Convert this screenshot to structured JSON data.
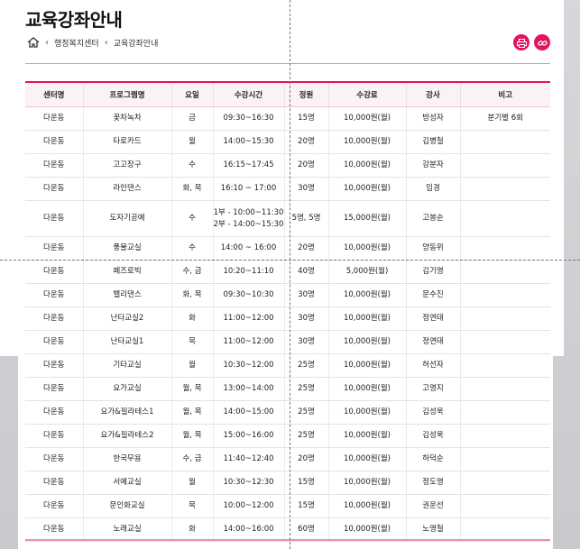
{
  "page_title": "교육강좌안내",
  "breadcrumb": {
    "items": [
      "행정복지센터",
      "교육강좌안내"
    ]
  },
  "icons": {
    "home": "home-icon",
    "print": "print-icon",
    "link": "link-icon",
    "accent_color": "#e2145f"
  },
  "table": {
    "headers": [
      "센터명",
      "프로그램명",
      "요일",
      "수강시간",
      "정원",
      "수강료",
      "강사",
      "비고"
    ],
    "rows": [
      {
        "center": "다운동",
        "program": "꽃차녹차",
        "day": "금",
        "time": "09:30~16:30",
        "time2": "",
        "capacity": "15명",
        "fee": "10,000원(월)",
        "teacher": "방성자",
        "note": "분기별 6회"
      },
      {
        "center": "다운동",
        "program": "타로카드",
        "day": "월",
        "time": "14:00~15:30",
        "time2": "",
        "capacity": "20명",
        "fee": "10,000원(월)",
        "teacher": "김병철",
        "note": ""
      },
      {
        "center": "다운동",
        "program": "고고장구",
        "day": "수",
        "time": "16:15~17:45",
        "time2": "",
        "capacity": "20명",
        "fee": "10,000원(월)",
        "teacher": "강분자",
        "note": ""
      },
      {
        "center": "다운동",
        "program": "라인댄스",
        "day": "화, 목",
        "time": "16:10 ~ 17:00",
        "time2": "",
        "capacity": "30명",
        "fee": "10,000원(월)",
        "teacher": "임경",
        "note": ""
      },
      {
        "center": "다운동",
        "program": "도자기공예",
        "day": "수",
        "time": "1부 - 10:00~11:30",
        "time2": "2부 - 14:00~15:30",
        "capacity": "5명, 5명",
        "fee": "15,000원(월)",
        "teacher": "고봉순",
        "note": ""
      },
      {
        "center": "다운동",
        "program": "풍물교실",
        "day": "수",
        "time": "14:00 ~ 16:00",
        "time2": "",
        "capacity": "20명",
        "fee": "10,000원(월)",
        "teacher": "양동위",
        "note": ""
      },
      {
        "center": "다운동",
        "program": "페즈로빅",
        "day": "수, 금",
        "time": "10:20~11:10",
        "time2": "",
        "capacity": "40명",
        "fee": "5,000원(월)",
        "teacher": "김기영",
        "note": ""
      },
      {
        "center": "다운동",
        "program": "밸리댄스",
        "day": "화, 목",
        "time": "09:30~10:30",
        "time2": "",
        "capacity": "30명",
        "fee": "10,000원(월)",
        "teacher": "문수진",
        "note": ""
      },
      {
        "center": "다운동",
        "program": "난타교실2",
        "day": "화",
        "time": "11:00~12:00",
        "time2": "",
        "capacity": "30명",
        "fee": "10,000원(월)",
        "teacher": "정연태",
        "note": ""
      },
      {
        "center": "다운동",
        "program": "난타교실1",
        "day": "목",
        "time": "11:00~12:00",
        "time2": "",
        "capacity": "30명",
        "fee": "10,000원(월)",
        "teacher": "정연태",
        "note": ""
      },
      {
        "center": "다운동",
        "program": "기타교실",
        "day": "월",
        "time": "10:30~12:00",
        "time2": "",
        "capacity": "25명",
        "fee": "10,000원(월)",
        "teacher": "허선자",
        "note": ""
      },
      {
        "center": "다운동",
        "program": "요가교실",
        "day": "월, 목",
        "time": "13:00~14:00",
        "time2": "",
        "capacity": "25명",
        "fee": "10,000원(월)",
        "teacher": "고영지",
        "note": ""
      },
      {
        "center": "다운동",
        "program": "요가&필라테스1",
        "day": "월, 목",
        "time": "14:00~15:00",
        "time2": "",
        "capacity": "25명",
        "fee": "10,000원(월)",
        "teacher": "김성욱",
        "note": ""
      },
      {
        "center": "다운동",
        "program": "요가&필라테스2",
        "day": "월, 목",
        "time": "15:00~16:00",
        "time2": "",
        "capacity": "25명",
        "fee": "10,000원(월)",
        "teacher": "김성욱",
        "note": ""
      },
      {
        "center": "다운동",
        "program": "한국무용",
        "day": "수, 금",
        "time": "11:40~12:40",
        "time2": "",
        "capacity": "20명",
        "fee": "10,000원(월)",
        "teacher": "하덕순",
        "note": ""
      },
      {
        "center": "다운동",
        "program": "서예교실",
        "day": "월",
        "time": "10:30~12:30",
        "time2": "",
        "capacity": "15명",
        "fee": "10,000원(월)",
        "teacher": "정도영",
        "note": ""
      },
      {
        "center": "다운동",
        "program": "문인화교실",
        "day": "목",
        "time": "10:00~12:00",
        "time2": "",
        "capacity": "15명",
        "fee": "10,000원(월)",
        "teacher": "권운선",
        "note": ""
      },
      {
        "center": "다운동",
        "program": "노래교실",
        "day": "화",
        "time": "14:00~16:00",
        "time2": "",
        "capacity": "60명",
        "fee": "10,000원(월)",
        "teacher": "노영철",
        "note": ""
      }
    ]
  }
}
